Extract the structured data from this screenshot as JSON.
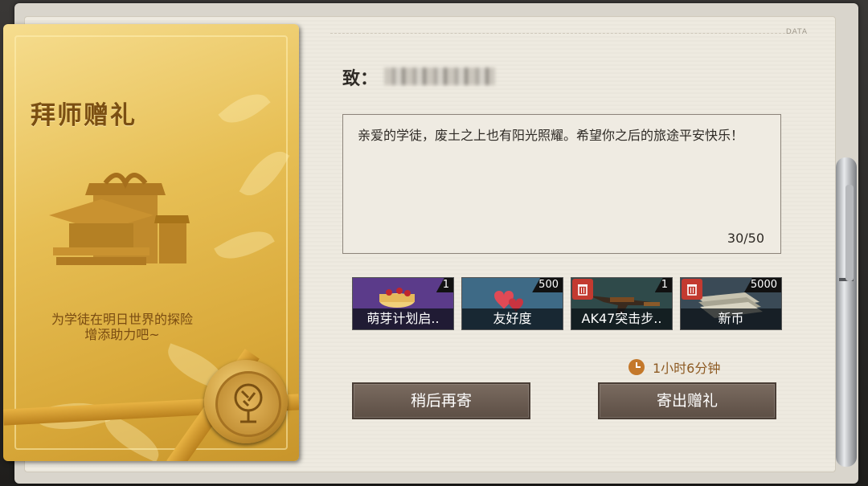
{
  "envelope": {
    "title": "拜师赠礼",
    "desc_line1": "为学徒在明日世界的探险",
    "desc_line2": "增添助力吧~"
  },
  "header": {
    "data_tag": "DATA"
  },
  "letter": {
    "to_label": "致：",
    "message": "亲爱的学徒，废土之上也有阳光照耀。希望你之后的旅途平安快乐！",
    "counter": "30/50"
  },
  "gifts": [
    {
      "name": "萌芽计划启..",
      "qty": "1",
      "icon": "cake-icon",
      "removable": false
    },
    {
      "name": "友好度",
      "qty": "500",
      "icon": "hearts-icon",
      "removable": false
    },
    {
      "name": "AK47突击步..",
      "qty": "1",
      "icon": "rifle-icon",
      "removable": true
    },
    {
      "name": "新币",
      "qty": "5000",
      "icon": "banknotes-icon",
      "removable": true
    }
  ],
  "timer": {
    "text": "1小时6分钟"
  },
  "buttons": {
    "later": "稍后再寄",
    "send": "寄出赠礼"
  },
  "colors": {
    "accent": "#c4782a",
    "button": "#6b5c52",
    "envelope": "#e7bf55",
    "trash": "#c33a30"
  }
}
